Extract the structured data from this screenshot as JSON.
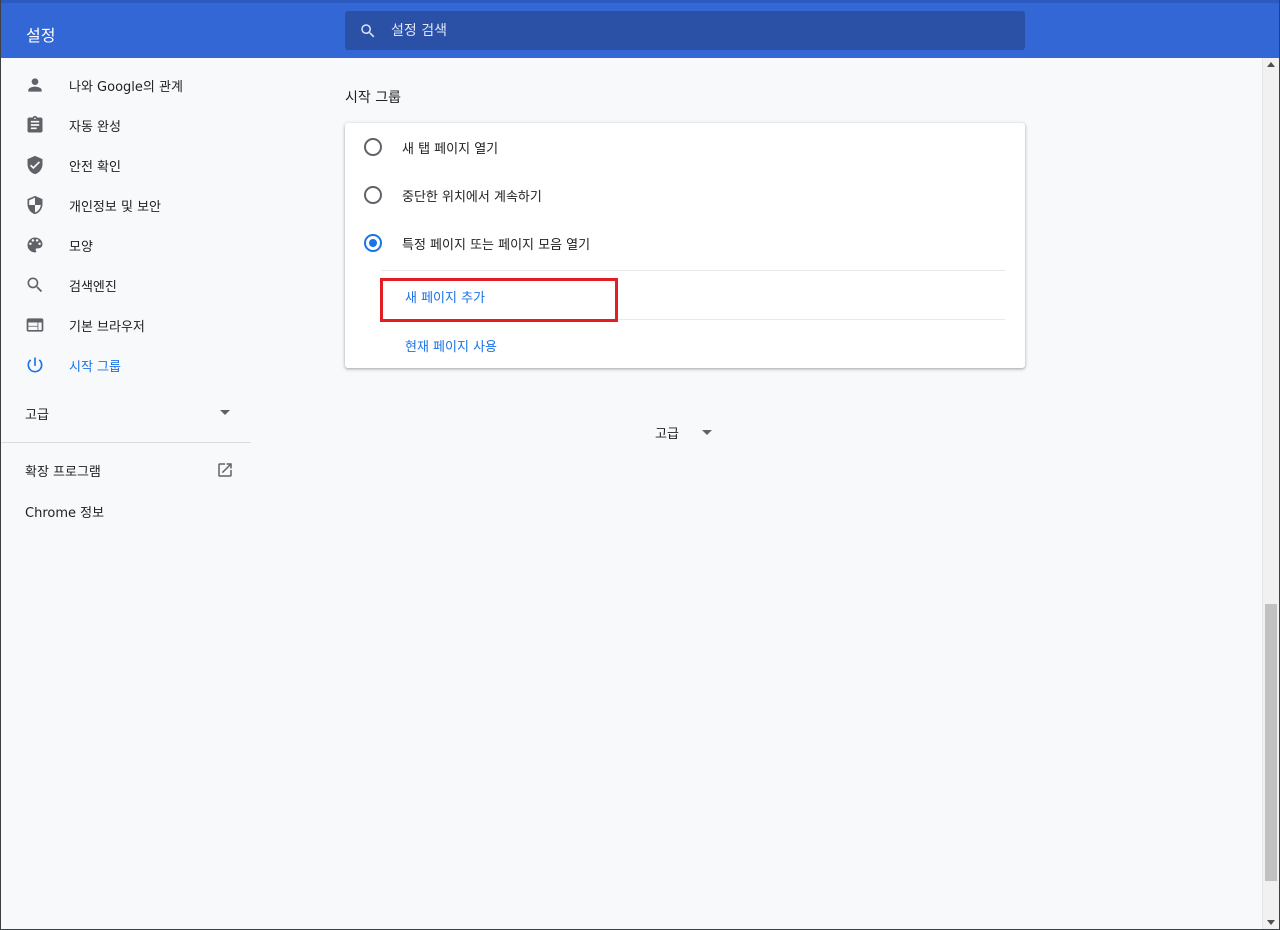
{
  "header": {
    "title": "설정",
    "search": {
      "placeholder": "설정 검색",
      "icon": "search-icon"
    }
  },
  "sidebar": {
    "items": [
      {
        "label": "나와 Google의 관계",
        "icon": "person-icon"
      },
      {
        "label": "자동 완성",
        "icon": "clipboard-icon"
      },
      {
        "label": "안전 확인",
        "icon": "shield-check-icon"
      },
      {
        "label": "개인정보 및 보안",
        "icon": "shield-half-icon"
      },
      {
        "label": "모양",
        "icon": "palette-icon"
      },
      {
        "label": "검색엔진",
        "icon": "search-icon"
      },
      {
        "label": "기본 브라우저",
        "icon": "browser-window-icon"
      },
      {
        "label": "시작 그룹",
        "icon": "power-icon",
        "active": true
      }
    ],
    "advanced_label": "고급",
    "extensions_label": "확장 프로그램",
    "about_label": "Chrome 정보"
  },
  "main": {
    "section_title": "시작 그룹",
    "options": [
      {
        "label": "새 탭 페이지 열기",
        "checked": false
      },
      {
        "label": "중단한 위치에서 계속하기",
        "checked": false
      },
      {
        "label": "특정 페이지 또는 페이지 모음 열기",
        "checked": true
      }
    ],
    "add_page_label": "새 페이지 추가",
    "use_current_label": "현재 페이지 사용",
    "advanced_label": "고급"
  },
  "colors": {
    "header_bg": "#3367d6",
    "accent": "#1a73e8",
    "highlight": "#e21d24"
  }
}
